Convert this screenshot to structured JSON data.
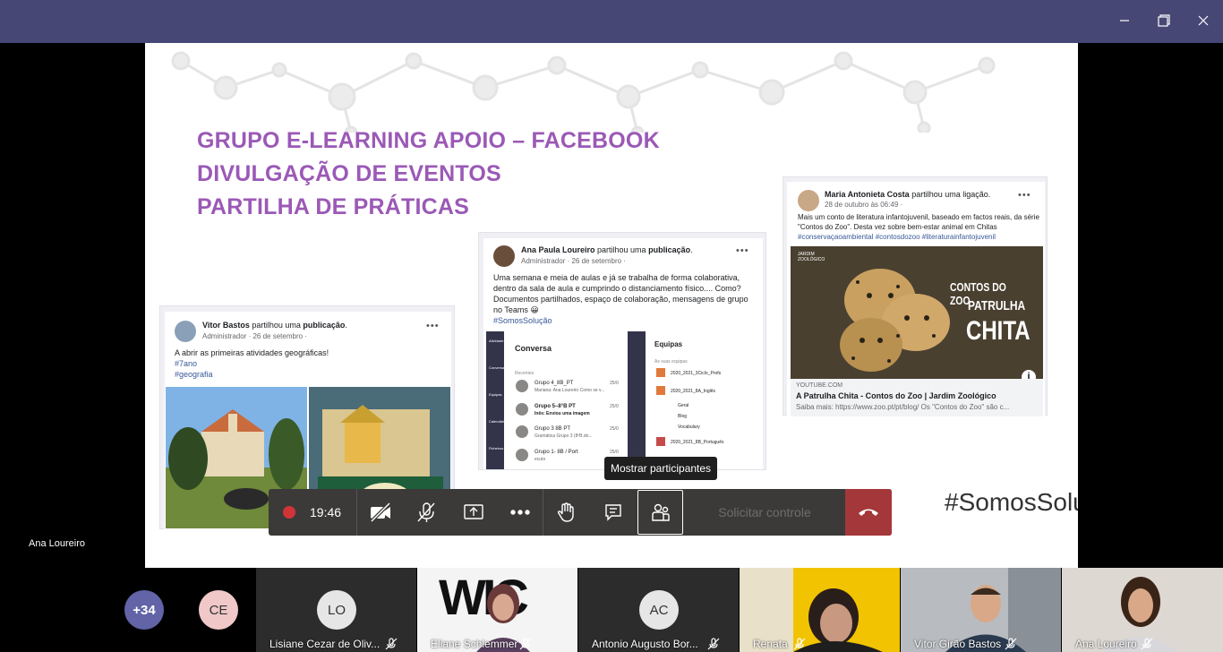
{
  "window": {
    "minimize_icon": "minimize-icon",
    "maximize_icon": "maximize-icon",
    "close_icon": "close-icon"
  },
  "slide": {
    "title_lines": [
      "GRUPO E-LEARNING APOIO – FACEBOOK",
      "DIVULGAÇÃO DE EVENTOS",
      "PARTILHA DE PRÁTICAS"
    ],
    "big_text": "#SomosSolução",
    "posts": {
      "vitor": {
        "author": "Vitor Bastos",
        "action": " partilhou uma ",
        "object": "publicação",
        "meta": "Administrador · 26 de setembro ·",
        "text": "A abrir as primeiras atividades geográficas!",
        "tags": [
          "#7ano",
          "#geografia"
        ]
      },
      "ana": {
        "author": "Ana Paula Loureiro",
        "action": " partilhou uma ",
        "object": "publicação",
        "meta": "Administrador · 26 de setembro ·",
        "text": "Uma semana e meia de aulas e já se trabalha de forma colaborativa, dentro da sala de aula e cumprindo o distanciamento físico.... Como? Documentos partilhados, espaço de colaboração, mensagens de grupo no Teams 😀",
        "tag": "#SomosSolução",
        "teams": {
          "chat_title": "Conversa",
          "recent_label": "Recentes",
          "chats": [
            {
              "name": "Grupo 4_8B_PT",
              "preview": "Mariana: Ana Loureiro Como se v...",
              "date": "25/0"
            },
            {
              "name": "Grupo 5–8°B PT",
              "preview": "Inês: Enviou uma imagem",
              "date": "25/0"
            },
            {
              "name": "Grupo 3 8B PT",
              "preview": "Gramática Grupo 3 (8ºB.do...",
              "date": "25/0"
            },
            {
              "name": "Grupo 1- 8B / Port",
              "preview": "ecuto",
              "date": "25/0"
            }
          ],
          "teams_title": "Equipas",
          "teams_label": "As suas equipas",
          "team_items": [
            "2020_2021_3Ciclo_Profs",
            "2020_2021_8A_Inglês",
            "Geral",
            "Blog",
            "Vocabulary",
            "2020_2021_8B_Português"
          ],
          "rail": [
            "Atividade",
            "Conversa",
            "Equipas",
            "Calendário",
            "Ficheiros"
          ]
        }
      },
      "maria": {
        "author": "Maria Antonieta Costa",
        "action": " partilhou uma ligação.",
        "meta": "28 de outubro às 06:49 ·",
        "text": "Mais um conto de literatura infantojuvenil, baseado em factos reais, da série \"Contos do Zoo\". Desta vez sobre bem-estar animal em Chitas",
        "tags": "#conservaçaoambiental #contosdozoo #literaturainfantojuvenil",
        "image_text": [
          "CONTOS DO ZOO",
          "PATRULHA",
          "CHITA"
        ],
        "logo_text": "JARDIM ZOOLÓGICO",
        "link_domain": "YOUTUBE.COM",
        "link_title": "A Patrulha Chita - Contos do Zoo | Jardim Zoológico",
        "link_desc": "Saiba mais: https://www.zoo.pt/pt/blog/ Os \"Contos do Zoo\" são c..."
      }
    }
  },
  "presenter_name": "Ana Loureiro",
  "toolbar": {
    "record_icon": "record-icon",
    "timer": "19:46",
    "request_control": "Solicitar controle",
    "tooltip": "Mostrar participantes"
  },
  "participants": {
    "overflow": "+34",
    "ce_initials": "CE",
    "tiles": [
      {
        "initials": "LO",
        "name": "Lisiane Cezar de Oliv..."
      },
      {
        "name": "Eliane Schlemmer"
      },
      {
        "initials": "AC",
        "name": "Antonio Augusto Bor..."
      },
      {
        "name": "Renata"
      },
      {
        "name": "Vitor Girão Bastos"
      },
      {
        "name": "Ana Loureiro"
      }
    ],
    "logo_text": "WIC"
  },
  "colors": {
    "teams_purple": "#464775",
    "slide_title": "#9b59b6",
    "hangup": "#a4373a",
    "avatar_purple": "#6264a7"
  }
}
